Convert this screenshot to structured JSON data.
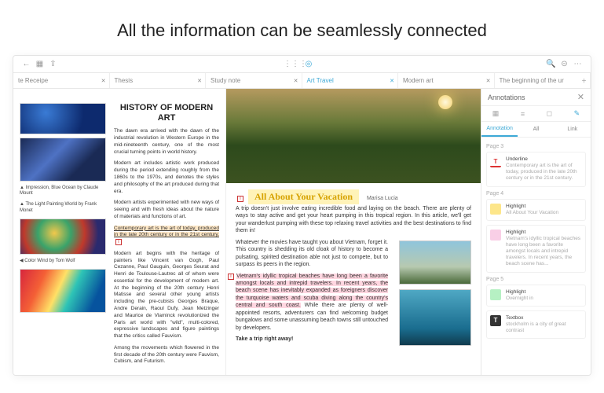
{
  "hero": {
    "title": "All the information can be seamlessly connected"
  },
  "tabs": [
    {
      "label": "te Receipe"
    },
    {
      "label": "Thesis"
    },
    {
      "label": "Study note"
    },
    {
      "label": "Art Travel",
      "active": true
    },
    {
      "label": "Modern art"
    },
    {
      "label": "The beginning of the ur"
    }
  ],
  "left": {
    "heading": "HISTORY OF MODERN ART",
    "p1": "The dawn era arrived with the dawn of the industrial revolution in Western Europe in the mid-nineteenth century, one of the most crucial turning points in world history.",
    "p2": "Modern art includes artistic work produced during the period extending roughly from the 1860s to the 1970s, and denotes the styles and philosophy of the art produced during that era.",
    "p3": "Modern artists experimented with new ways of seeing and with fresh ideas about the nature of materials and functions of art.",
    "hl": "Contemporary art is the art of today, produced in the late 20th century or in the 21st century.",
    "p4": "Modern art begins with the heritage of painters like Vincent van Gogh, Paul Cezanne, Paul Gauguin, Georges Seurat and Henri de Toulouse-Lautrec all of whom were essential for the development of modern art. At the beginning of the 20th century Henri Matisse and several other young artists including the pre-cubists Georges Braque, Andre Derain, Raoul Dufy, Jean Metzinger and Maurice de Vlaminck revolutionized the Paris art world with \"wild\", multi-colored, expressive landscapes and figure paintings that the critics called Fauvism.",
    "p5": "Among the movements which flowered in the first decade of the 20th century were Fauvism, Cubism, and Futurism.",
    "caps": {
      "c1": "▲ Impression, Blue Ocean by Claude Mount",
      "c2": "▲ The Light Painting World by Frank Monet",
      "c3": "◀ Color Wind by Tom Wolf"
    }
  },
  "right": {
    "title": "All About Your Vacation",
    "byline": "Marisa Lucia",
    "p1": "A trip doesn't just involve eating incredible food and laying on the beach. There are plenty of ways to stay active and get your heart pumping in this tropical region. In this article, we'll get your wanderlust pumping with these top relaxing travel activities and the best destinations to find them in!",
    "p2": "Whatever the movies have taught you about Vietnam, forget it. This country is shedding its old cloak of history to become a pulsating, spirited destination able not just to compete, but to surpass its peers in the region.",
    "hl": "Vietnam's idyllic tropical beaches have long been a favorite amongst locals and intrepid travelers. In recent years, the beach scene has inevitably expanded as foreigners discover the turquoise waters and scuba diving along the country's central and south coast.",
    "p3": "While there are plenty of well-appointed resorts, adventurers can find welcoming budget bungalows and some unassuming beach towns still untouched by developers.",
    "cta": "Take a trip right away!"
  },
  "panel": {
    "title": "Annotations",
    "tabs": {
      "a": "Annotation",
      "b": "All",
      "c": "Link"
    },
    "pages": {
      "p3": "Page 3",
      "p4": "Page 4",
      "p5": "Page 5"
    },
    "items": [
      {
        "type": "Underline",
        "col": "red",
        "snippet": "Contemporary art is the art of today, produced in the late 20th century or in the 21st century."
      },
      {
        "type": "Highlight",
        "col": "yellow",
        "snippet": "All About Your Vacation"
      },
      {
        "type": "Highlight",
        "col": "pink",
        "snippet": "Vietnam's idyllic tropical beaches have long been a favorite amongst locals and intrepid travelers. In recent years, the beach scene has..."
      },
      {
        "type": "Highlight",
        "col": "green",
        "snippet": "Overnight in"
      },
      {
        "type": "Textbox",
        "col": "black",
        "snippet": "stockholm is a city of great contrast"
      }
    ]
  }
}
